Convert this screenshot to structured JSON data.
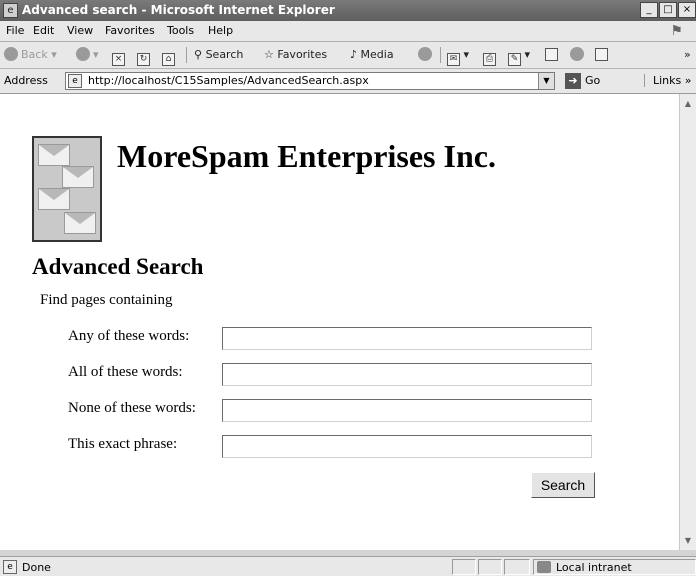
{
  "window": {
    "title": "Advanced search - Microsoft Internet Explorer",
    "buttons": {
      "minimize": "_",
      "maximize": "□",
      "close": "×"
    }
  },
  "menu": [
    "File",
    "Edit",
    "View",
    "Favorites",
    "Tools",
    "Help"
  ],
  "toolbar": {
    "back": "Back",
    "search": "Search",
    "favorites": "Favorites",
    "media": "Media"
  },
  "address": {
    "label": "Address",
    "url": "http://localhost/C15Samples/AdvancedSearch.aspx",
    "go": "Go",
    "links": "Links"
  },
  "page": {
    "company": "MoreSpam Enterprises Inc.",
    "heading": "Advanced Search",
    "subtext": "Find pages containing",
    "fields": [
      {
        "label": "Any of these words:",
        "value": ""
      },
      {
        "label": "All of these words:",
        "value": ""
      },
      {
        "label": "None of these words:",
        "value": ""
      },
      {
        "label": "This exact phrase:",
        "value": ""
      }
    ],
    "search_button": "Search"
  },
  "status": {
    "text": "Done",
    "zone": "Local intranet"
  }
}
